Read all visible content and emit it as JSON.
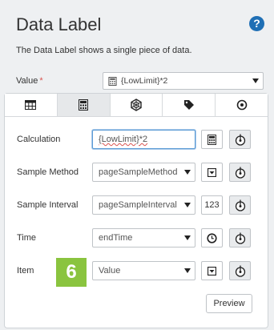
{
  "header": {
    "title": "Data Label",
    "help_glyph": "?",
    "description": "The Data Label shows a single piece of data."
  },
  "value_field": {
    "label": "Value",
    "required_mark": "*",
    "selected": "{LowLimit}*2"
  },
  "tabs": [
    {
      "icon": "table-icon",
      "active": false
    },
    {
      "icon": "calculator-icon",
      "active": true
    },
    {
      "icon": "hexagon-network-icon",
      "active": false
    },
    {
      "icon": "tag-icon",
      "active": false
    },
    {
      "icon": "target-icon",
      "active": false
    }
  ],
  "form": {
    "calculation": {
      "label": "Calculation",
      "value": "{LowLimit}*2"
    },
    "sample_method": {
      "label": "Sample Method",
      "value": "pageSampleMethod"
    },
    "sample_interval": {
      "label": "Sample Interval",
      "value": "pageSampleInterval",
      "alt_button": "123"
    },
    "time": {
      "label": "Time",
      "value": "endTime"
    },
    "item": {
      "label": "Item",
      "value": "Value"
    }
  },
  "callout_badge": "6",
  "preview_button": "Preview",
  "colors": {
    "accent": "#1f6fb5",
    "badge": "#8ac43f",
    "required": "#d9534f"
  }
}
